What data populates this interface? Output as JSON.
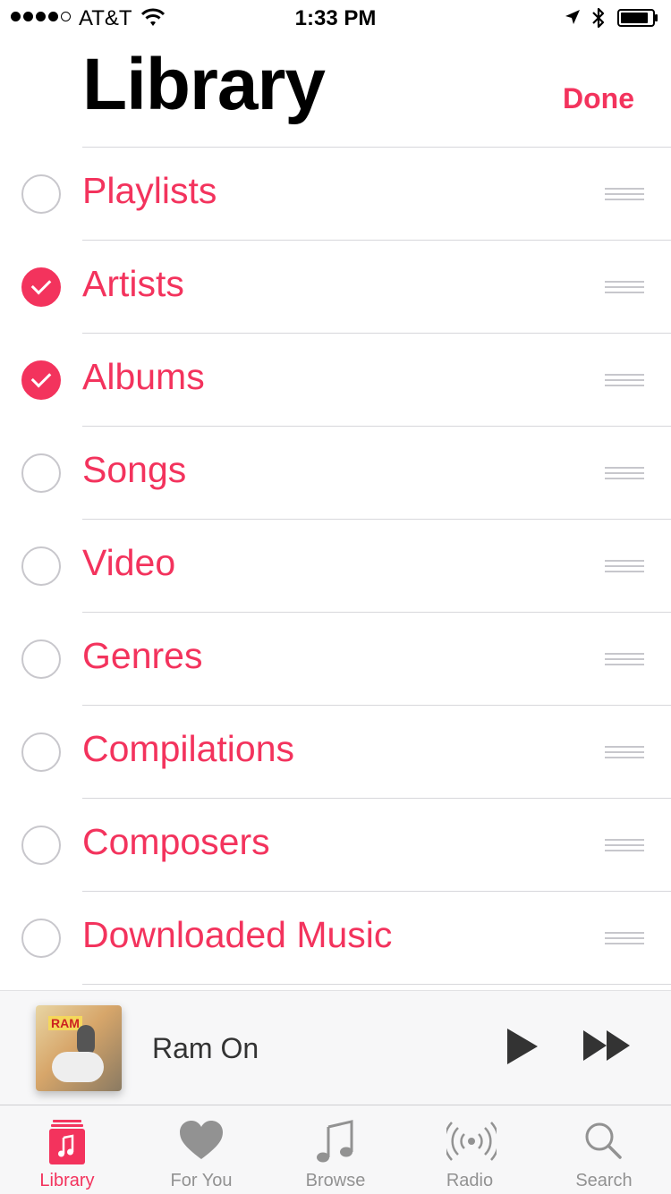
{
  "status_bar": {
    "carrier": "AT&T",
    "time": "1:33 PM",
    "signal_bars": 4,
    "signal_total": 5
  },
  "header": {
    "title": "Library",
    "done_label": "Done"
  },
  "library_items": [
    {
      "label": "Playlists",
      "checked": false
    },
    {
      "label": "Artists",
      "checked": true
    },
    {
      "label": "Albums",
      "checked": true
    },
    {
      "label": "Songs",
      "checked": false
    },
    {
      "label": "Video",
      "checked": false
    },
    {
      "label": "Genres",
      "checked": false
    },
    {
      "label": "Compilations",
      "checked": false
    },
    {
      "label": "Composers",
      "checked": false
    },
    {
      "label": "Downloaded Music",
      "checked": false
    }
  ],
  "mini_player": {
    "song_title": "Ram On",
    "album_art_text": "RAM"
  },
  "tab_bar": {
    "tabs": [
      {
        "label": "Library",
        "icon": "library-icon",
        "active": true
      },
      {
        "label": "For You",
        "icon": "heart-icon",
        "active": false
      },
      {
        "label": "Browse",
        "icon": "music-note-icon",
        "active": false
      },
      {
        "label": "Radio",
        "icon": "radio-icon",
        "active": false
      },
      {
        "label": "Search",
        "icon": "search-icon",
        "active": false
      }
    ]
  },
  "colors": {
    "accent": "#f3335d",
    "inactive": "#929292"
  }
}
